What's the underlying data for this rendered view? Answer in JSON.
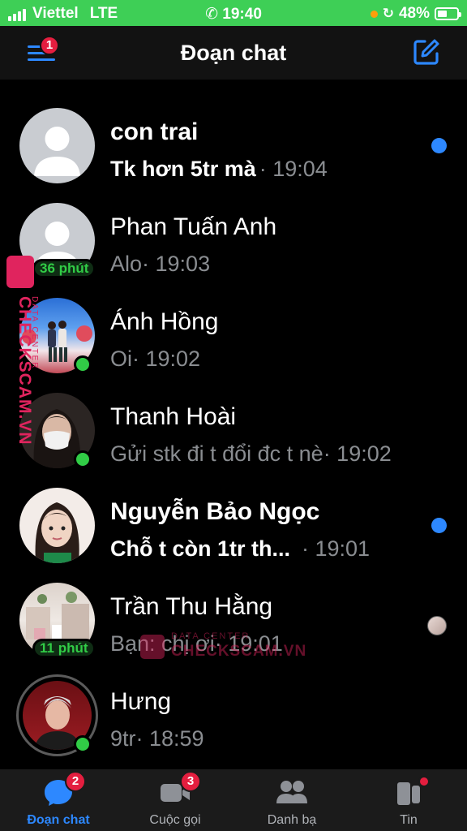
{
  "status_bar": {
    "carrier": "Viettel",
    "network": "LTE",
    "time": "19:40",
    "battery": "48%",
    "battery_level": 0.48,
    "color": "#3ecf56"
  },
  "header": {
    "title": "Đoạn chat",
    "menu_badge": "1",
    "compose_icon": "compose-icon"
  },
  "chats": [
    {
      "name": "con trai",
      "message": "Tk hơn 5tr mà",
      "time": "· 19:04",
      "unread": true,
      "indicator": "unread-dot",
      "avatar": "default-avatar"
    },
    {
      "name": "Phan Tuấn Anh",
      "message": "Alo",
      "time": "· 19:03",
      "unread": false,
      "active_label": "36 phút",
      "avatar": "default-avatar"
    },
    {
      "name": "Ánh Hồng",
      "message": "Oi",
      "time": "· 19:02",
      "unread": false,
      "online": true,
      "avatar": "photo-couple"
    },
    {
      "name": "Thanh Hoài",
      "message": "Gửi stk đi t đổi đc t nè",
      "time": "· 19:02",
      "unread": false,
      "online": true,
      "avatar": "photo-mask"
    },
    {
      "name": "Nguyễn Bảo Ngọc",
      "message": "Chỗ t còn 1tr th...",
      "time": " · 19:01",
      "unread": true,
      "indicator": "unread-dot",
      "avatar": "photo-girl"
    },
    {
      "name": "Trần Thu Hằng",
      "message": "Bạn: chị ơi",
      "time": "· 19:01",
      "unread": false,
      "active_label": "11 phút",
      "indicator": "seen-avatar",
      "avatar": "photo-room"
    },
    {
      "name": "Hưng",
      "message": "9tr",
      "time": "· 18:59",
      "unread": false,
      "online": true,
      "story_ring": true,
      "avatar": "photo-man"
    }
  ],
  "tabs": [
    {
      "label": "Đoạn chat",
      "badge": "2",
      "icon": "chat-bubble-icon",
      "active": true
    },
    {
      "label": "Cuộc gọi",
      "badge": "3",
      "icon": "video-camera-icon",
      "active": false
    },
    {
      "label": "Danh bạ",
      "badge": "",
      "icon": "people-icon",
      "active": false
    },
    {
      "label": "Tin",
      "badge": "",
      "icon": "stories-icon",
      "active": false,
      "dot": true
    }
  ],
  "watermark": {
    "side_text": "CHECKSCAM.VN",
    "side_sub": "DATA CENTER",
    "center_sub": "DATA CENTER",
    "center_text": "CHECKSCAM.VN"
  },
  "colors": {
    "accent": "#2d88ff",
    "online": "#31cc46",
    "badge": "#e41e3f",
    "watermark": "#e0245e"
  }
}
